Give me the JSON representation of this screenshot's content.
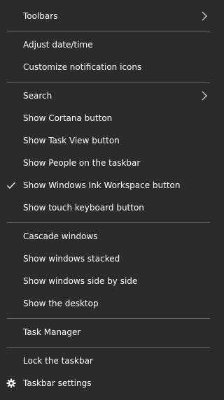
{
  "colors": {
    "background": "#2b2b2b",
    "text": "#ffffff",
    "separator": "#6a6a6a"
  },
  "menu": {
    "toolbars": {
      "label": "Toolbars",
      "icon": "chevron-right-icon"
    },
    "adjust_date_time": {
      "label": "Adjust date/time"
    },
    "customize_notification_icons": {
      "label": "Customize notification icons"
    },
    "search": {
      "label": "Search",
      "icon": "chevron-right-icon"
    },
    "show_cortana_button": {
      "label": "Show Cortana button"
    },
    "show_task_view_button": {
      "label": "Show Task View button"
    },
    "show_people": {
      "label": "Show People on the taskbar"
    },
    "show_windows_ink": {
      "label": "Show Windows Ink Workspace button",
      "checked": true,
      "icon": "checkmark-icon"
    },
    "show_touch_keyboard": {
      "label": "Show touch keyboard button"
    },
    "cascade_windows": {
      "label": "Cascade windows"
    },
    "show_windows_stacked": {
      "label": "Show windows stacked"
    },
    "show_windows_side_by_side": {
      "label": "Show windows side by side"
    },
    "show_desktop": {
      "label": "Show the desktop"
    },
    "task_manager": {
      "label": "Task Manager"
    },
    "lock_taskbar": {
      "label": "Lock the taskbar"
    },
    "taskbar_settings": {
      "label": "Taskbar settings",
      "icon": "gear-icon"
    }
  }
}
